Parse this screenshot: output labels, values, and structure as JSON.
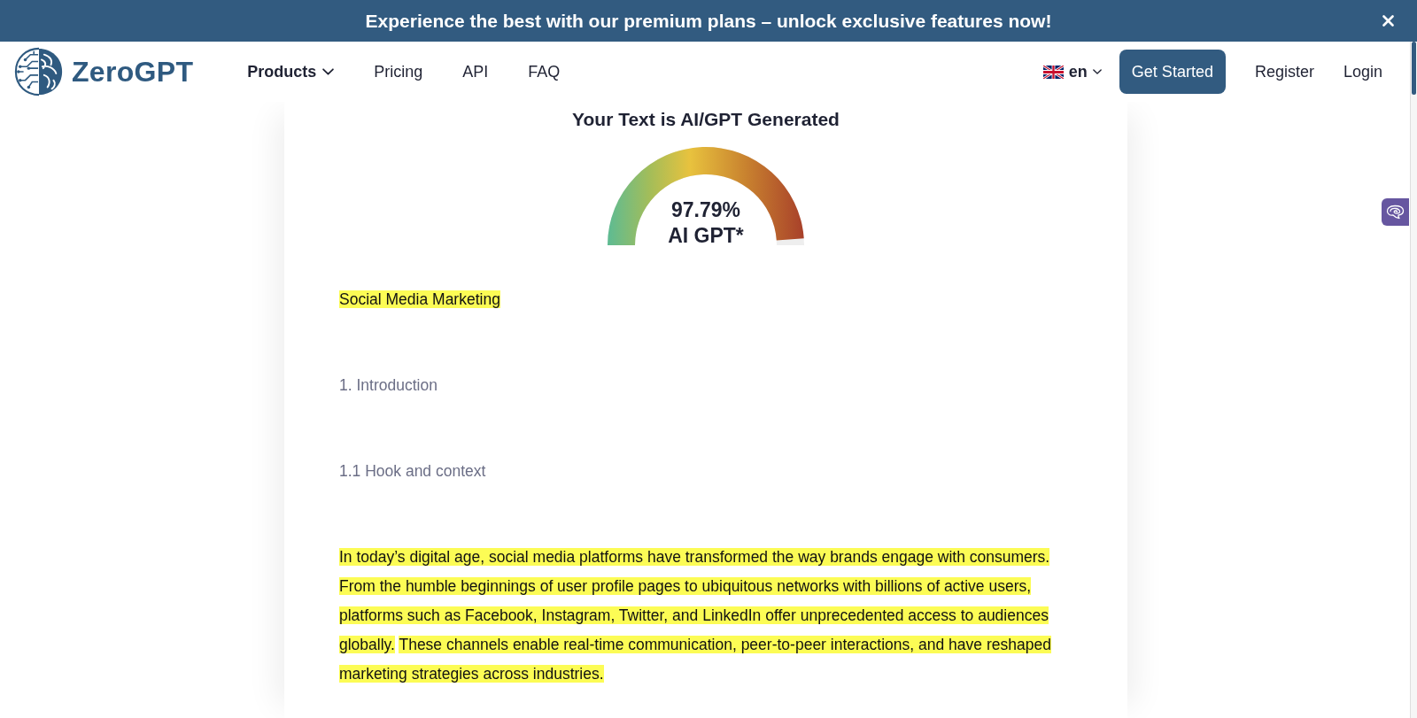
{
  "banner": {
    "text": "Experience the best with our premium plans – unlock exclusive features now!"
  },
  "nav": {
    "logo": "ZeroGPT",
    "links": [
      {
        "label": "Products",
        "kind": "dropdown"
      },
      {
        "label": "Pricing",
        "kind": "link"
      },
      {
        "label": "API",
        "kind": "link"
      },
      {
        "label": "FAQ",
        "kind": "link"
      }
    ],
    "language": "en",
    "cta": "Get Started",
    "auth": [
      "Register",
      "Login"
    ]
  },
  "result": {
    "title": "Your Text is AI/GPT Generated",
    "level": 0.9779,
    "score": "97.79%",
    "label": "AI GPT*"
  },
  "content": [
    {
      "segments": [
        {
          "text": "Social Media Marketing",
          "highlighted": true
        }
      ]
    },
    {
      "segments": [
        {
          "text": "1. Introduction",
          "highlighted": false
        }
      ]
    },
    {
      "segments": [
        {
          "text": "1.1 Hook and context",
          "highlighted": false
        }
      ]
    },
    {
      "segments": [
        {
          "text": "In today’s digital age, social media platforms have transformed the way brands engage with consumers. From the humble beginnings of user profile pages to ubiquitous networks with billions of active users, platforms such as Facebook, Instagram, Twitter, and LinkedIn offer unprecedented access to audiences globally.",
          "highlighted": true
        },
        {
          "text": "These channels enable real-time communication, peer-to-peer interactions, and have reshaped marketing strategies across industries.",
          "highlighted": true
        }
      ]
    }
  ]
}
